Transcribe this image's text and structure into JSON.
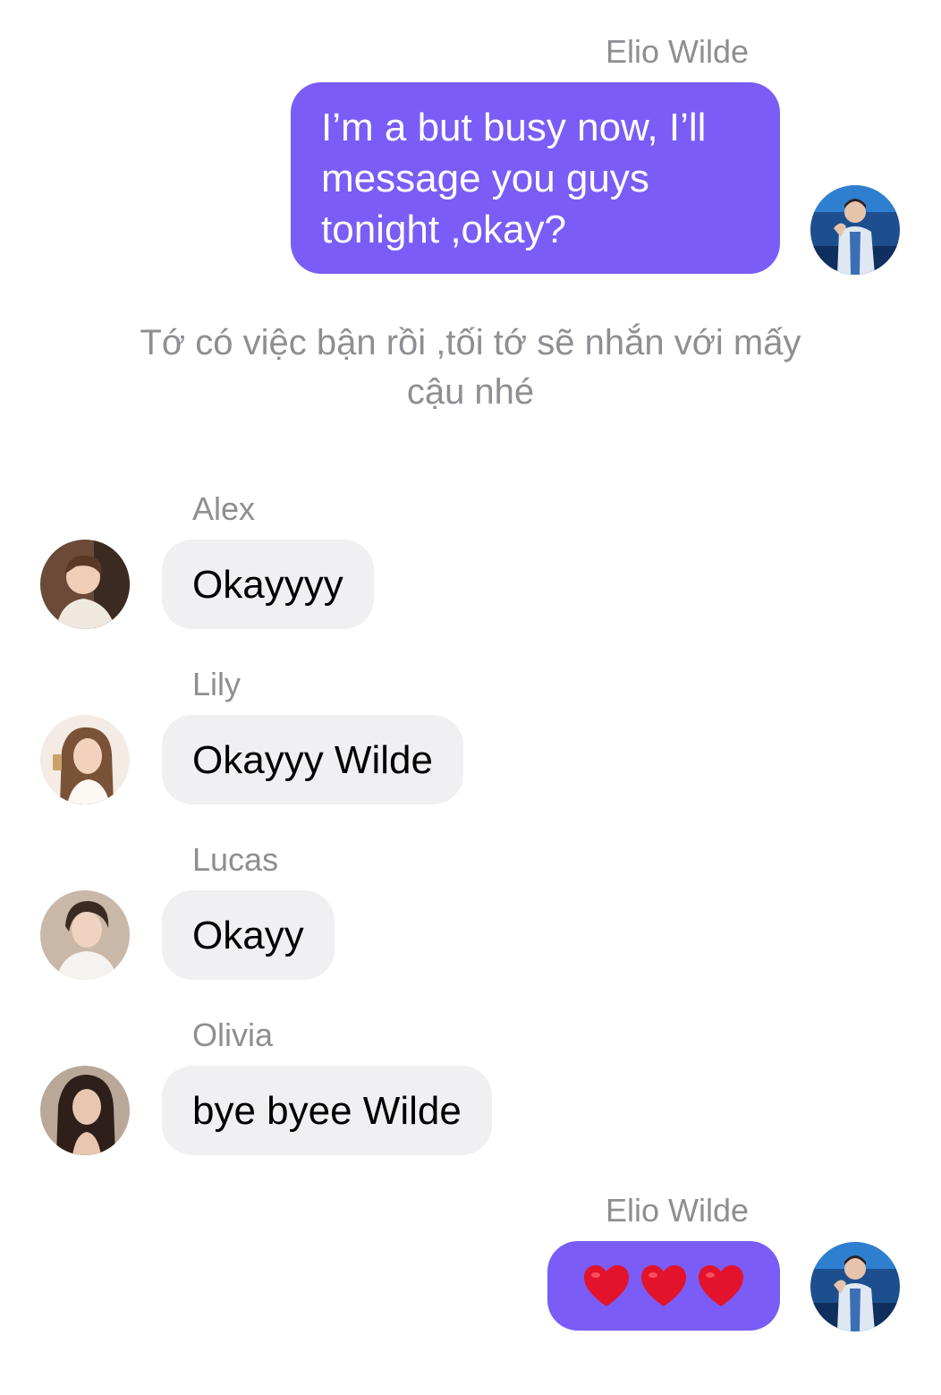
{
  "colors": {
    "outgoing_bubble": "#7b5cf6",
    "incoming_bubble": "#f0f0f2",
    "sender_name": "#8e8e93",
    "heart": "#e3132b"
  },
  "messages": [
    {
      "sender": "Elio Wilde",
      "text": "I’m a but busy now, I’ll message you guys tonight ,okay?",
      "translation": "Tớ có việc bận rồi ,tối tớ sẽ nhắn với mấy cậu nhé",
      "direction": "outgoing"
    },
    {
      "sender": "Alex",
      "text": "Okayyyy",
      "direction": "incoming"
    },
    {
      "sender": "Lily",
      "text": "Okayyy Wilde",
      "direction": "incoming"
    },
    {
      "sender": "Lucas",
      "text": "Okayy",
      "direction": "incoming"
    },
    {
      "sender": "Olivia",
      "text": "bye byee Wilde",
      "direction": "incoming"
    },
    {
      "sender": "Elio Wilde",
      "emoji": [
        "heart-emoji",
        "heart-emoji",
        "heart-emoji"
      ],
      "direction": "outgoing"
    }
  ]
}
